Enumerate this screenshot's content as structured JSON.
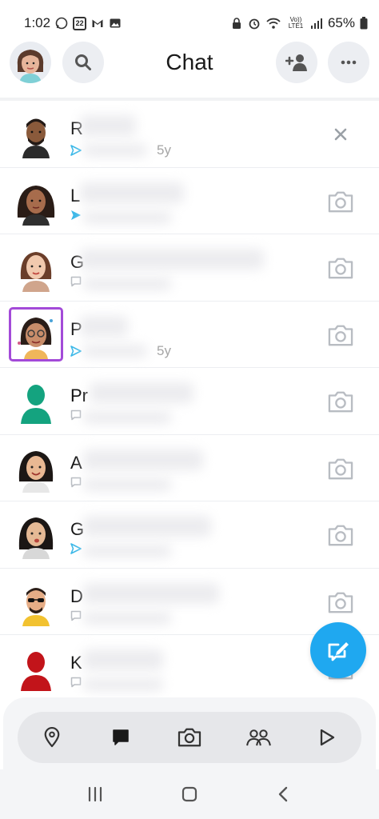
{
  "status_bar": {
    "time": "1:02",
    "calendar_day": "22",
    "battery": "65%",
    "network": "Vo)) LTE1"
  },
  "header": {
    "title": "Chat"
  },
  "chats": [
    {
      "initial": "R",
      "status_icon": "sent-arrow-icon",
      "time": "5y",
      "action": "close-icon"
    },
    {
      "initial": "L",
      "status_icon": "sent-arrow-icon",
      "time": "",
      "action": "camera-icon"
    },
    {
      "initial": "G",
      "status_icon": "chat-bubble-icon",
      "time": "",
      "action": "camera-icon"
    },
    {
      "initial": "P",
      "status_icon": "sent-arrow-icon",
      "time": "5y",
      "action": "camera-icon"
    },
    {
      "initial": "Pr",
      "status_icon": "chat-bubble-icon",
      "time": "",
      "action": "camera-icon"
    },
    {
      "initial": "A",
      "status_icon": "chat-bubble-icon",
      "time": "",
      "action": "camera-icon"
    },
    {
      "initial": "G",
      "status_icon": "sent-arrow-icon",
      "time": "",
      "action": "camera-icon"
    },
    {
      "initial": "D",
      "status_icon": "chat-bubble-icon",
      "time": "",
      "action": "camera-icon"
    },
    {
      "initial": "K",
      "status_icon": "chat-bubble-icon",
      "time": "",
      "action": "camera-icon"
    }
  ],
  "colors": {
    "accent": "#1fa8f0",
    "selection": "#a34ad8",
    "sent_arrow": "#3bb8e8",
    "icon_gray": "#b8bcc2"
  },
  "bottom_nav": [
    "map-pin-icon",
    "chat-icon",
    "camera-icon",
    "friends-icon",
    "play-icon"
  ]
}
